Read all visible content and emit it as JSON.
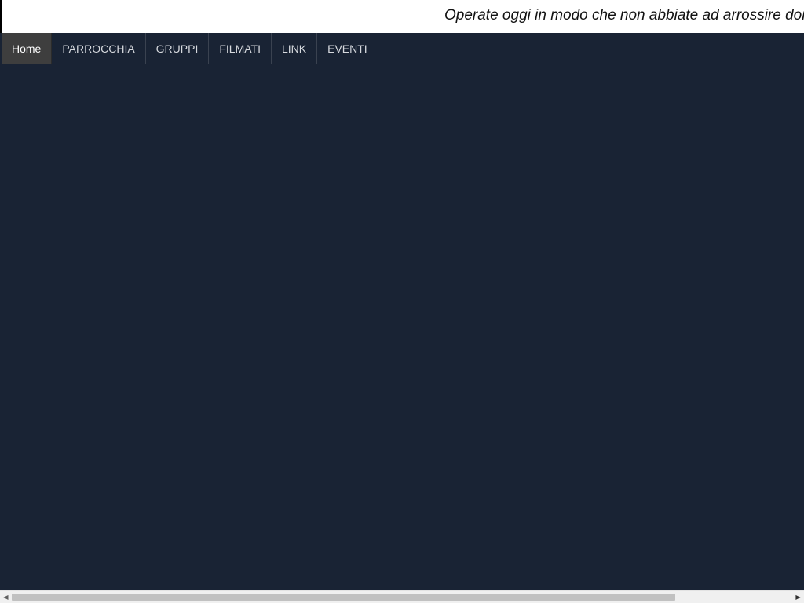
{
  "banner": {
    "marquee_text": "Operate oggi in modo che non abbiate ad arrossire domani"
  },
  "nav": {
    "items": [
      {
        "label": "Home",
        "active": true
      },
      {
        "label": "PARROCCHIA",
        "active": false
      },
      {
        "label": "GRUPPI",
        "active": false
      },
      {
        "label": "FILMATI",
        "active": false
      },
      {
        "label": "LINK",
        "active": false
      },
      {
        "label": "EVENTI",
        "active": false
      }
    ]
  },
  "scrollbar": {
    "left_arrow_icon": "triangle-left-icon",
    "right_arrow_icon": "triangle-right-icon",
    "position_fraction": 0.0,
    "visible_fraction": 0.83
  },
  "colors": {
    "page_background": "#192334",
    "banner_background": "#ffffff",
    "active_nav_background": "#3e3e3e",
    "nav_text": "#d6d9de"
  }
}
